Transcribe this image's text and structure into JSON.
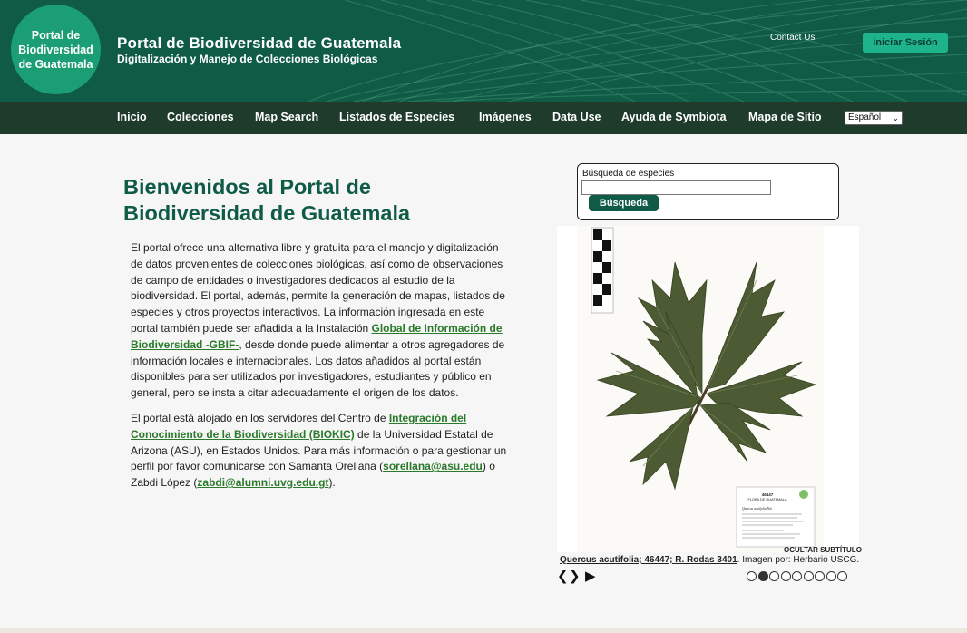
{
  "header": {
    "logo_lines": [
      "Portal de",
      "Biodiversidad",
      "de Guatemala"
    ],
    "title": "Portal de Biodiversidad de Guatemala",
    "subtitle": "Digitalización y Manejo de Colecciones Biológicas",
    "contact_label": "Contact Us",
    "login_label": "iniciar Sesión"
  },
  "nav": {
    "items": [
      "Inicio",
      "Colecciones",
      "Map Search",
      "Listados de Especies",
      "Imágenes",
      "Data Use",
      "Ayuda de Symbiota",
      "Mapa de Sitio"
    ],
    "language_selected": "Español"
  },
  "main": {
    "welcome_line1": "Bienvenidos al Portal de",
    "welcome_line2": "Biodiversidad de Guatemala",
    "p1_text1": "El portal ofrece una alternativa libre y gratuita para el manejo y digitalización de datos provenientes de colecciones biológicas, así como de observaciones de campo de entidades o investigadores dedicados al estudio de la biodiversidad. El portal, además, permite la generación de mapas, listados de especies y otros proyectos interactivos. La información ingresada en este portal también puede ser añadida a la Instalación ",
    "p1_link": "Global de Información de Biodiversidad -GBIF-",
    "p1_text2": ", desde donde puede alimentar a otros agregadores de información locales e internacionales. Los datos añadidos al portal están disponibles para ser utilizados por investigadores, estudiantes y público en general, pero se insta a citar adecuadamente el origen de los datos.",
    "p2_text1": "El portal está alojado en los servidores del Centro de ",
    "p2_link1": "Integración del Conocimiento de la Biodiversidad (BIOKIC)",
    "p2_text2": " de la Universidad Estatal de Arizona (ASU), en Estados Unidos. Para más información o para gestionar un perfil por favor comunicarse con Samanta Orellana (",
    "p2_link2": "sorellana@asu.edu",
    "p2_text3": ") o Zabdi López (",
    "p2_link3": "zabdi@alumni.uvg.edu.gt",
    "p2_text4": ")."
  },
  "search": {
    "label": "Búsqueda de especies",
    "value": "",
    "button": "Búsqueda"
  },
  "slideshow": {
    "hide_caption": "OCULTAR SUBTÍTULO",
    "caption_link": "Quercus acutifolia; 46447; R. Rodas 3401",
    "caption_text": ". Imagen por: Herbario USCG.",
    "prev_icon": "❮",
    "next_icon": "❯",
    "play_icon": "▶",
    "dot_count": 9,
    "active_dot": 1
  },
  "specimen_label": {
    "number": "46447",
    "herbarium": "FLORA DE GUATEMALA",
    "species": "Quercus acutifolia Née"
  },
  "colors": {
    "brand_green": "#0f5b46",
    "nav_dark": "#1e3b2c",
    "accent": "#1fb38c",
    "link_green": "#2b7a2b"
  }
}
